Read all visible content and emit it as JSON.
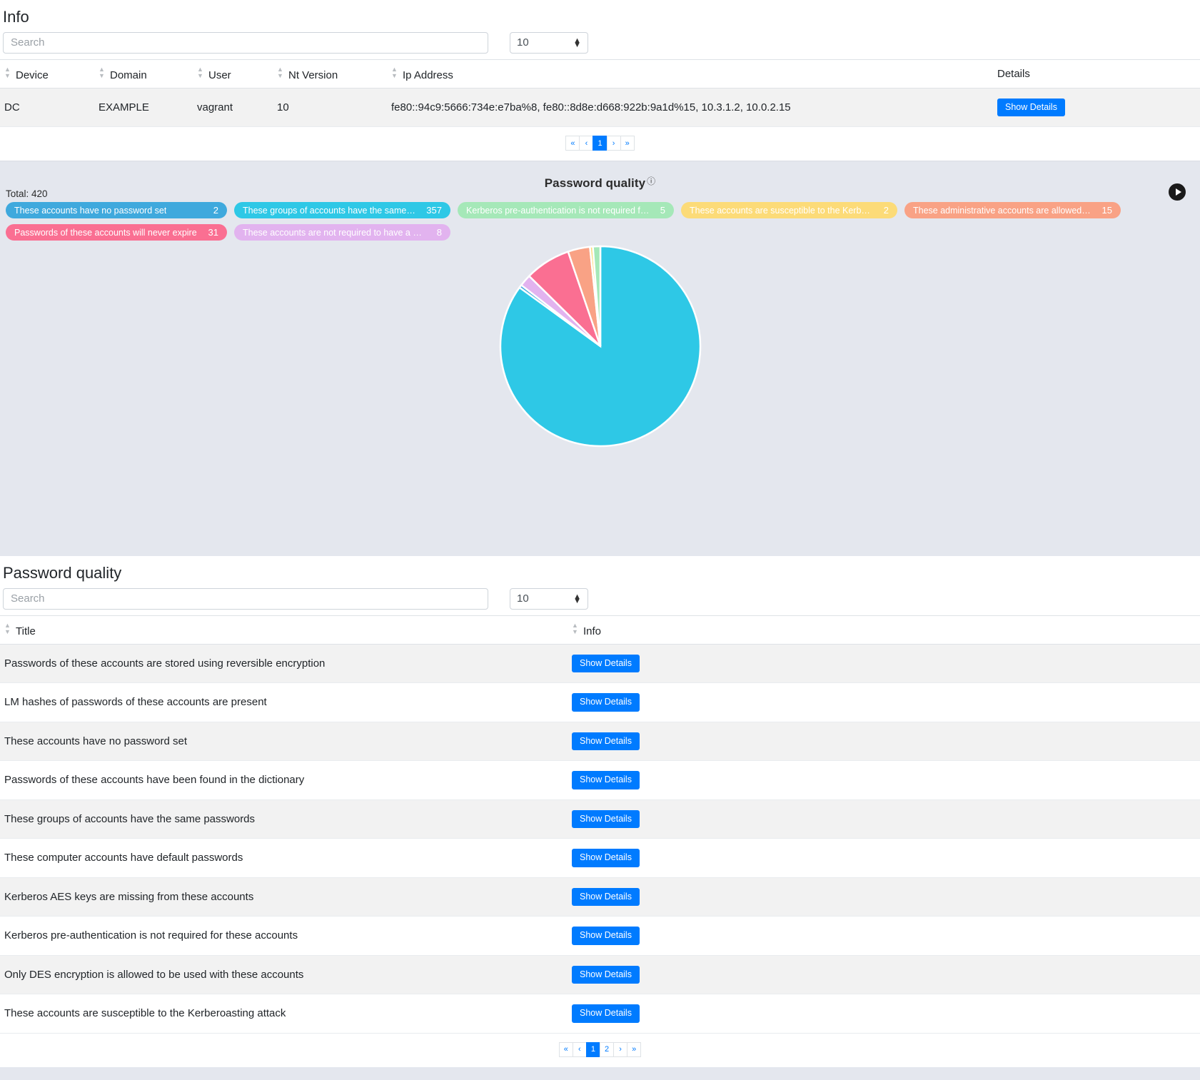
{
  "info_section": {
    "title": "Info",
    "search_placeholder": "Search",
    "page_size": "10",
    "columns": [
      "Device",
      "Domain",
      "User",
      "Nt Version",
      "Ip Address",
      "Details"
    ],
    "rows": [
      {
        "device": "DC",
        "domain": "EXAMPLE",
        "user": "vagrant",
        "nt_version": "10",
        "ip_address": "fe80::94c9:5666:734e:e7ba%8, fe80::8d8e:d668:922b:9a1d%15, 10.3.1.2, 10.0.2.15",
        "details_label": "Show Details"
      }
    ],
    "pagination": [
      "«",
      "‹",
      "1",
      "›",
      "»"
    ],
    "active_page": "1"
  },
  "chart_panel": {
    "title": "Password quality",
    "help_icon": "question-circle-icon",
    "total_label": "Total: 420",
    "play_icon": "play-circle-icon"
  },
  "chart_data": {
    "type": "pie",
    "title": "Password quality",
    "total": 420,
    "legend_position": "top",
    "categories": [
      "These accounts have no password set",
      "These groups of accounts have the same passwo…",
      "Kerberos pre-authentication is not required for thes…",
      "These accounts are susceptible to the Kerberoastin…",
      "These administrative accounts are allowed to be d…",
      "Passwords of these accounts will never expire",
      "These accounts are not required to have a password"
    ],
    "values": [
      2,
      357,
      5,
      2,
      15,
      31,
      8
    ],
    "colors": [
      "#3fa9dd",
      "#2ec8e6",
      "#a5e8b8",
      "#fcdb78",
      "#f9a285",
      "#fa6f92",
      "#e2b3ef"
    ]
  },
  "quality_section": {
    "title": "Password quality",
    "search_placeholder": "Search",
    "page_size": "10",
    "columns": [
      "Title",
      "Info"
    ],
    "rows": [
      {
        "title": "Passwords of these accounts are stored using reversible encryption",
        "details_label": "Show Details"
      },
      {
        "title": "LM hashes of passwords of these accounts are present",
        "details_label": "Show Details"
      },
      {
        "title": "These accounts have no password set",
        "details_label": "Show Details"
      },
      {
        "title": "Passwords of these accounts have been found in the dictionary",
        "details_label": "Show Details"
      },
      {
        "title": "These groups of accounts have the same passwords",
        "details_label": "Show Details"
      },
      {
        "title": "These computer accounts have default passwords",
        "details_label": "Show Details"
      },
      {
        "title": "Kerberos AES keys are missing from these accounts",
        "details_label": "Show Details"
      },
      {
        "title": "Kerberos pre-authentication is not required for these accounts",
        "details_label": "Show Details"
      },
      {
        "title": "Only DES encryption is allowed to be used with these accounts",
        "details_label": "Show Details"
      },
      {
        "title": "These accounts are susceptible to the Kerberoasting attack",
        "details_label": "Show Details"
      }
    ],
    "pagination": [
      "«",
      "‹",
      "1",
      "2",
      "›",
      "»"
    ],
    "active_page": "1"
  }
}
